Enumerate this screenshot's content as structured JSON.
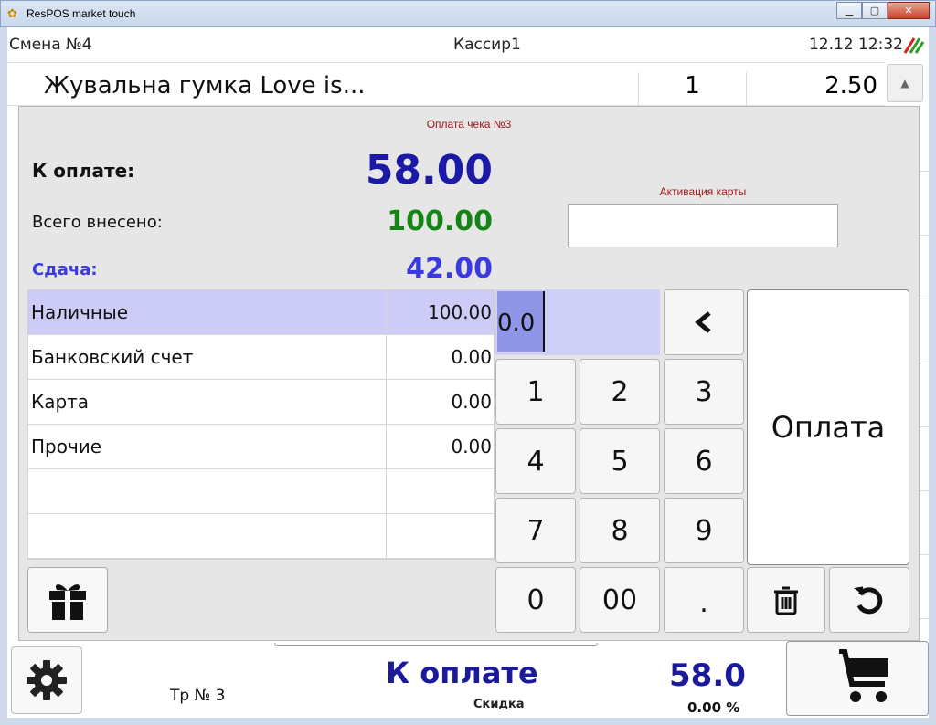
{
  "window": {
    "title": "ResPOS market touch",
    "buttons": {
      "minimize": "▁",
      "maximize": "▢",
      "close": "✕"
    }
  },
  "header": {
    "shift": "Смена №4",
    "cashier": "Кассир1",
    "datetime": "12.12 12:32",
    "sync_icon": "sync-status-icon"
  },
  "receipt": {
    "item_name": "Жувальна гумка Love is...",
    "item_qty": "1",
    "item_sum": "2.50",
    "scroll_up": "▲"
  },
  "dialog": {
    "title": "Оплата чека №3",
    "due_label": "К оплате:",
    "due_value": "58.00",
    "paid_label": "Всего внесено:",
    "paid_value": "100.00",
    "change_label": "Сдача:",
    "change_value": "42.00",
    "card_label": "Активация карты",
    "card_value": "",
    "methods": [
      {
        "name": "Наличные",
        "amount": "100.00"
      },
      {
        "name": "Банковский счет",
        "amount": "0.00"
      },
      {
        "name": "Карта",
        "amount": "0.00"
      },
      {
        "name": "Прочие",
        "amount": "0.00"
      },
      {
        "name": "",
        "amount": ""
      },
      {
        "name": "",
        "amount": ""
      }
    ],
    "amount_input": "0.0",
    "keys": {
      "k1": "1",
      "k2": "2",
      "k3": "3",
      "k4": "4",
      "k5": "5",
      "k6": "6",
      "k7": "7",
      "k8": "8",
      "k9": "9",
      "k0": "0",
      "k00": "00",
      "kdot": "."
    },
    "backspace": "‹",
    "pay_label": "Оплата"
  },
  "bottom": {
    "tr_label": "Тр № 3",
    "to_pay_label": "К оплате",
    "to_pay_value": "58.0",
    "discount_label": "Скидка",
    "discount_value": "0.00 %"
  },
  "colors": {
    "due": "#1a1aa6",
    "paid": "#148414",
    "change": "#3a3ae0",
    "selected_row": "#ccccf6",
    "dialog_title": "#a01818"
  }
}
